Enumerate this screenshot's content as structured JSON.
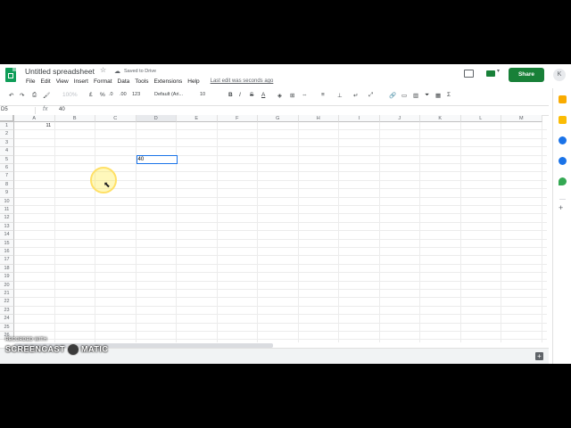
{
  "app": {
    "title": "Untitled spreadsheet",
    "saved_status": "Saved to Drive",
    "last_edit": "Last edit was seconds ago",
    "share_label": "Share",
    "avatar_initial": "K",
    "brand_color": "#188038"
  },
  "menu": [
    "File",
    "Edit",
    "View",
    "Insert",
    "Format",
    "Data",
    "Tools",
    "Extensions",
    "Help"
  ],
  "toolbar": {
    "zoom": "100%",
    "currency": "£",
    "percent": "%",
    "dec_dec": ".0",
    "dec_inc": ".00",
    "more_formats": "123",
    "font": "Default (Ari...",
    "font_size": "10",
    "bold": "B",
    "italic": "I",
    "strike": "S",
    "text_color": "A",
    "sum": "Σ"
  },
  "formula_bar": {
    "name_box": "D5",
    "fx": "fx",
    "value": "40"
  },
  "columns": [
    "A",
    "B",
    "C",
    "D",
    "E",
    "F",
    "G",
    "H",
    "I",
    "J",
    "K",
    "L",
    "M"
  ],
  "rows": [
    "1",
    "2",
    "3",
    "4",
    "5",
    "6",
    "7",
    "8",
    "9",
    "10",
    "11",
    "12",
    "13",
    "14",
    "15",
    "16",
    "17",
    "18",
    "19",
    "20",
    "21",
    "22",
    "23",
    "24",
    "25",
    "26"
  ],
  "cells": {
    "A1": "11",
    "D5_editing": "40"
  },
  "watermark": {
    "top": "RECORDED WITH",
    "left": "SCREENCAST",
    "right": "MATIC"
  }
}
